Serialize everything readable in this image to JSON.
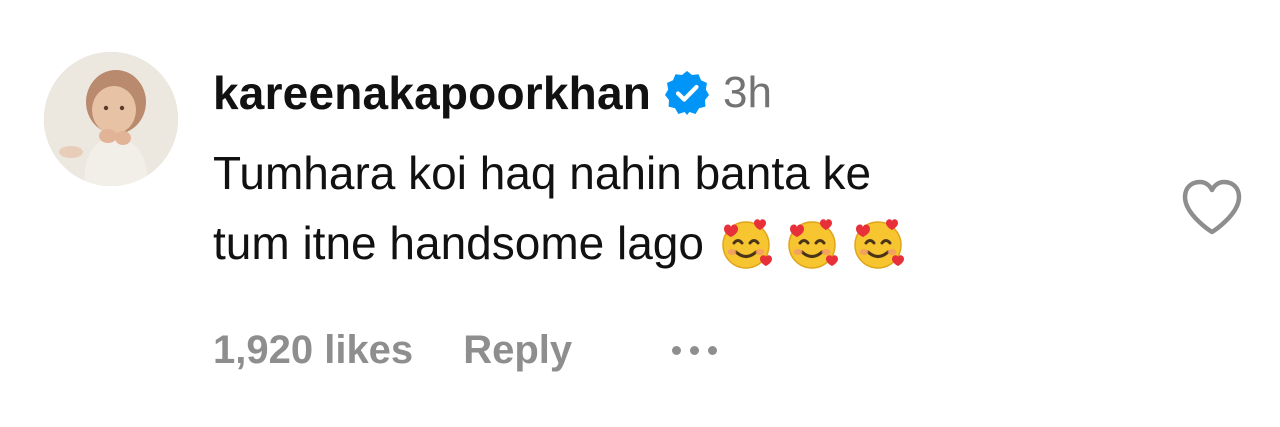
{
  "comment": {
    "username": "kareenakapoorkhan",
    "verified": true,
    "time": "3h",
    "text_lines": [
      "Tumhara koi haq nahin banta ke",
      "tum itne handsome lago"
    ],
    "emojis": [
      "smiling-face-with-hearts",
      "smiling-face-with-hearts",
      "smiling-face-with-hearts"
    ],
    "likes": "1,920 likes",
    "reply_label": "Reply",
    "more_icon": "more-dots-icon",
    "like_icon": "heart-outline-icon"
  },
  "colors": {
    "text": "#111111",
    "secondary": "#737373",
    "footer": "#8e8e8e",
    "verified_blue": "#0095f6",
    "background": "#ffffff"
  }
}
